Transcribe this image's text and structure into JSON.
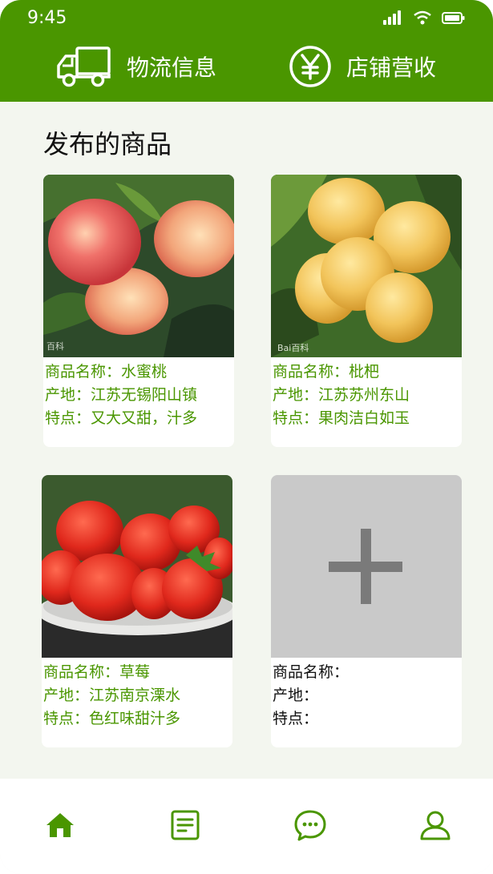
{
  "status_bar": {
    "time": "9:45"
  },
  "header": {
    "logistics_label": "物流信息",
    "revenue_label": "店铺营收"
  },
  "section_title": "发布的商品",
  "products": [
    {
      "name": "商品名称：水蜜桃",
      "origin": "产地：江苏无锡阳山镇",
      "feature": "特点：又大又甜，汁多",
      "watermark": "百科"
    },
    {
      "name": "商品名称：枇杷",
      "origin": "产地：江苏苏州东山",
      "feature": "特点：果肉洁白如玉",
      "watermark": "Bai百科"
    },
    {
      "name": "商品名称：草莓",
      "origin": "产地：江苏南京溧水",
      "feature": "特点：色红味甜汁多"
    }
  ],
  "new_product": {
    "name": "商品名称：",
    "origin": "产地：",
    "feature": "特点："
  },
  "tabs": [
    {
      "icon": "home-icon",
      "active": true
    },
    {
      "icon": "document-icon",
      "active": false
    },
    {
      "icon": "chat-icon",
      "active": false
    },
    {
      "icon": "user-icon",
      "active": false
    }
  ],
  "colors": {
    "brand_green": "#4a9600",
    "background": "#f3f6ef",
    "placeholder_gray": "#c9c9c9"
  }
}
